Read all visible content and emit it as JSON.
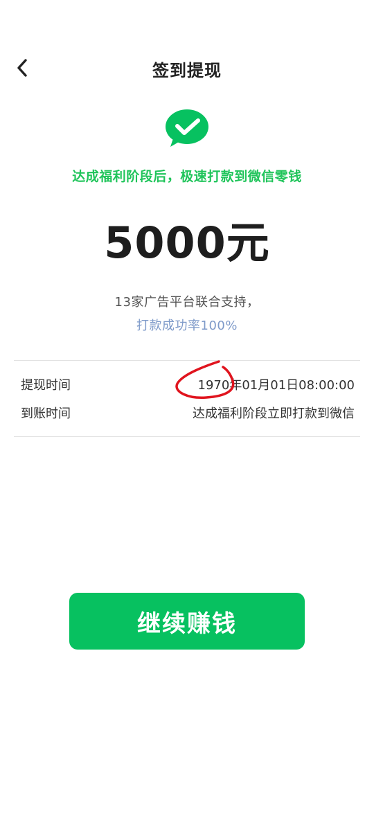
{
  "header": {
    "title": "签到提现",
    "back_icon": "chevron-left-icon"
  },
  "logo": {
    "icon": "wechat-pay-icon",
    "color": "#07c160"
  },
  "subtitle": "达成福利阶段后，极速打款到微信零钱",
  "amount": "5000元",
  "support_text": "13家广告平台联合支持，",
  "success_rate_text": "打款成功率100%",
  "info": {
    "rows": [
      {
        "label": "提现时间",
        "value": "1970年01月01日08:00:00"
      },
      {
        "label": "到账时间",
        "value": "达成福利阶段立即打款到微信"
      }
    ]
  },
  "annotation": {
    "color": "#e0141e"
  },
  "button": {
    "label": "继续赚钱",
    "color": "#07c160"
  }
}
